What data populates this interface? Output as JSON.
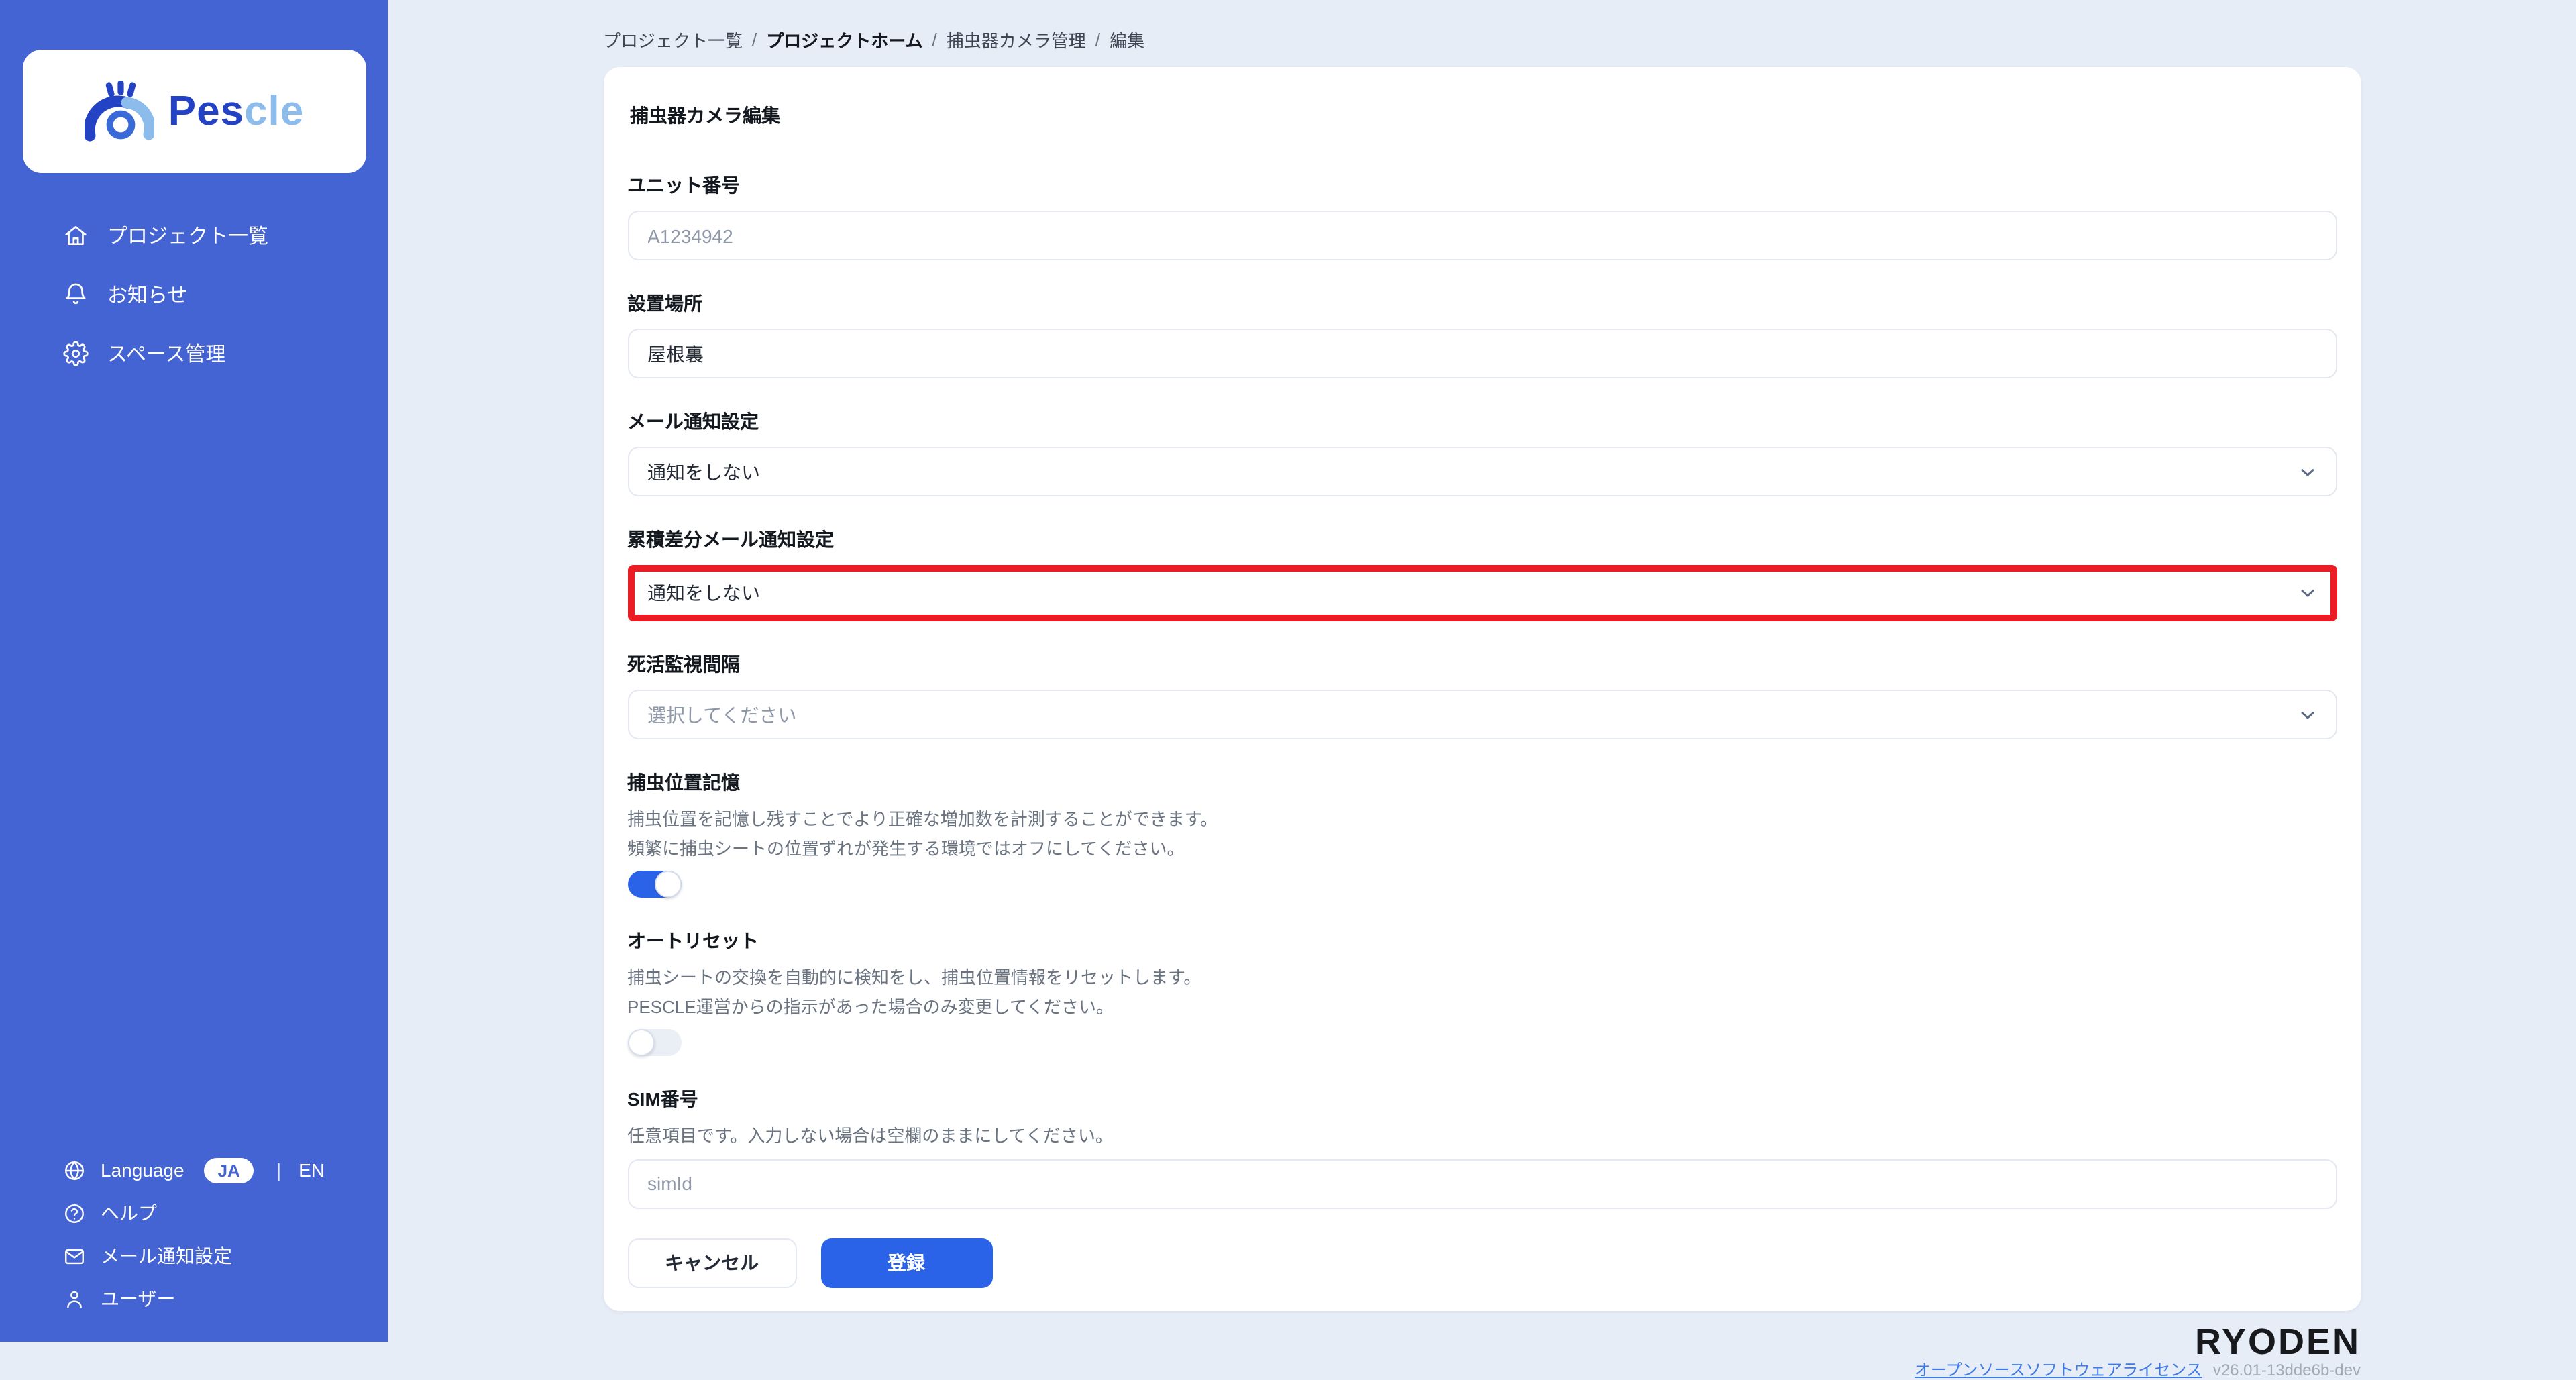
{
  "brand": {
    "word_primary": "Pes",
    "word_secondary": "cle"
  },
  "sidebar": {
    "items": [
      {
        "icon": "home-icon",
        "label": "プロジェクト一覧"
      },
      {
        "icon": "bell-icon",
        "label": "お知らせ"
      },
      {
        "icon": "gear-icon",
        "label": "スペース管理"
      }
    ],
    "language": {
      "label": "Language",
      "active": "JA",
      "separator": "|",
      "inactive": "EN"
    },
    "bottom_items": [
      {
        "icon": "help-icon",
        "label": "ヘルプ"
      },
      {
        "icon": "mail-icon",
        "label": "メール通知設定"
      },
      {
        "icon": "user-icon",
        "label": "ユーザー"
      }
    ]
  },
  "breadcrumb": {
    "separator": "/",
    "items": [
      "プロジェクト一覧",
      "プロジェクトホーム",
      "捕虫器カメラ管理",
      "編集"
    ]
  },
  "form": {
    "title": "捕虫器カメラ編集",
    "unit_number": {
      "label": "ユニット番号",
      "placeholder": "A1234942"
    },
    "location": {
      "label": "設置場所",
      "value": "屋根裏"
    },
    "mail_notification": {
      "label": "メール通知設定",
      "value": "通知をしない"
    },
    "cumulative_mail_notification": {
      "label": "累積差分メール通知設定",
      "value": "通知をしない",
      "highlighted": true
    },
    "alive_monitoring": {
      "label": "死活監視間隔",
      "placeholder": "選択してください"
    },
    "position_memory": {
      "label": "捕虫位置記憶",
      "desc1": "捕虫位置を記憶し残すことでより正確な増加数を計測することができます。",
      "desc2": "頻繁に捕虫シートの位置ずれが発生する環境ではオフにしてください。",
      "state": "on"
    },
    "auto_reset": {
      "label": "オートリセット",
      "desc1": "捕虫シートの交換を自動的に検知をし、捕虫位置情報をリセットします。",
      "desc2": "PESCLE運営からの指示があった場合のみ変更してください。",
      "state": "off"
    },
    "sim_number": {
      "label": "SIM番号",
      "desc": "任意項目です。入力しない場合は空欄のままにしてください。",
      "placeholder": "simId"
    },
    "cancel_label": "キャンセル",
    "submit_label": "登録"
  },
  "footer": {
    "logo": "RYODEN",
    "license_link": "オープンソースソフトウェアライセンス",
    "version": "v26.01-13dde6b-dev"
  },
  "colors": {
    "sidebar": "#4564D3",
    "page_bg": "#E7EDF7",
    "accent_blue": "#2B63E8",
    "error_red": "#EC1C24",
    "logo_dark_blue": "#2443C4",
    "logo_light_blue": "#8BBCEC",
    "link_blue": "#3E7BE8"
  }
}
